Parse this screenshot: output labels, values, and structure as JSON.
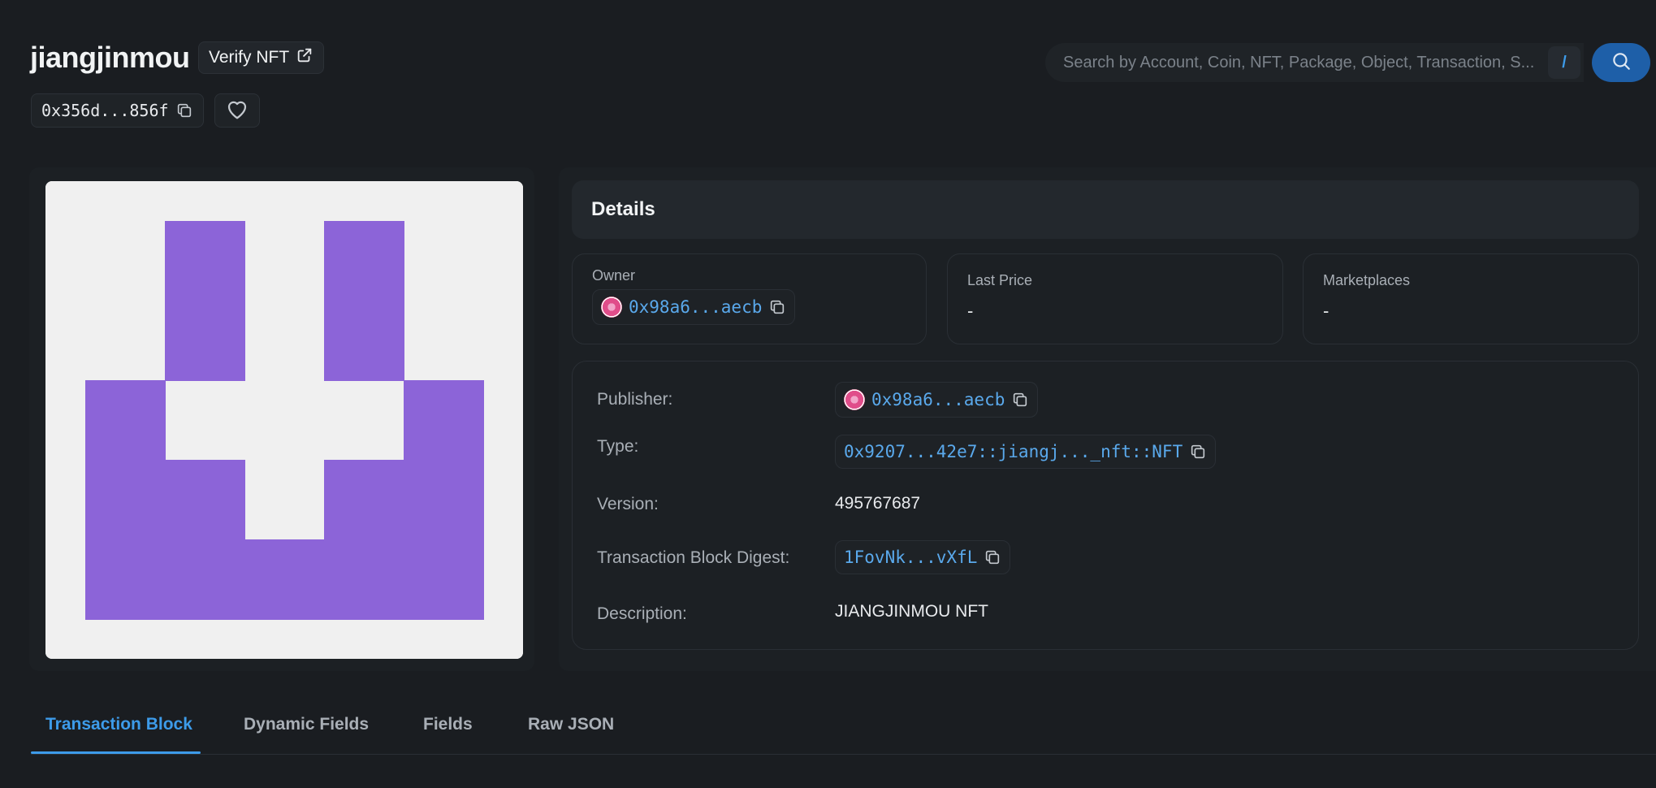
{
  "header": {
    "title": "jiangjinmou",
    "verify_label": "Verify NFT",
    "object_id": "0x356d...856f",
    "search_placeholder": "Search by Account, Coin, NFT, Package, Object, Transaction, S...",
    "search_shortcut": "/"
  },
  "nft_image": {
    "background": "#f0f0f0",
    "fill": "#8c64d8"
  },
  "details": {
    "heading": "Details",
    "owner": {
      "label": "Owner",
      "value": "0x98a6...aecb"
    },
    "last_price": {
      "label": "Last Price",
      "value": "-"
    },
    "marketplaces": {
      "label": "Marketplaces",
      "value": "-"
    },
    "properties": {
      "publisher": {
        "label": "Publisher:",
        "value": "0x98a6...aecb"
      },
      "type": {
        "label": "Type:",
        "value": "0x9207...42e7::jiangj..._nft::NFT"
      },
      "version": {
        "label": "Version:",
        "value": "495767687"
      },
      "digest": {
        "label": "Transaction Block Digest:",
        "value": "1FovNk...vXfL"
      },
      "description": {
        "label": "Description:",
        "value": "JIANGJINMOU NFT"
      }
    }
  },
  "tabs": [
    {
      "label": "Transaction Block",
      "active": true
    },
    {
      "label": "Dynamic Fields",
      "active": false
    },
    {
      "label": "Fields",
      "active": false
    },
    {
      "label": "Raw JSON",
      "active": false
    }
  ],
  "colors": {
    "accent": "#3d9be9",
    "link": "#5aa9ec",
    "background": "#1a1d21",
    "search_button": "#1e5fa8"
  }
}
